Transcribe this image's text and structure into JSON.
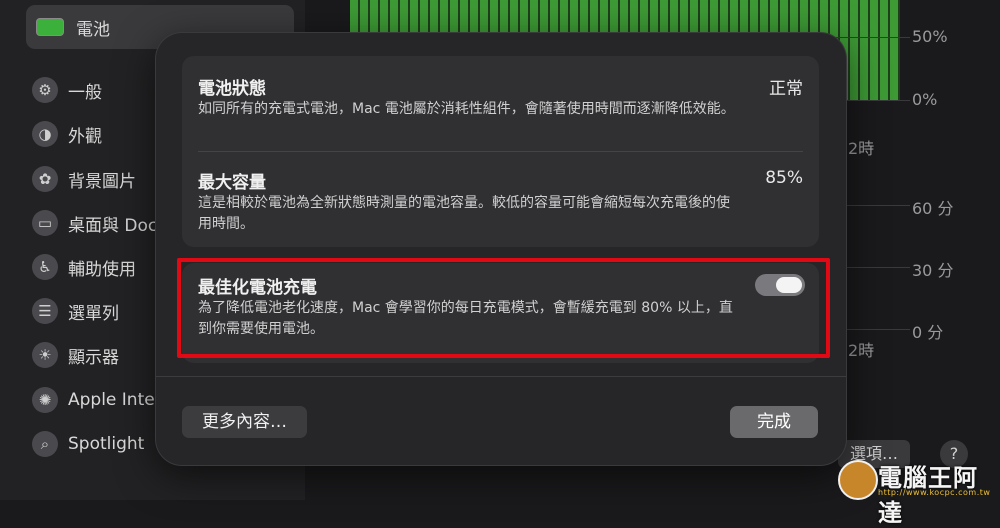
{
  "sidebar": {
    "selected": {
      "label": "電池",
      "icon": "battery-icon"
    },
    "items": [
      {
        "label": "一般",
        "icon": "gear-icon",
        "glyph": "⚙"
      },
      {
        "label": "外觀",
        "icon": "appearance-icon",
        "glyph": "◑"
      },
      {
        "label": "背景圖片",
        "icon": "wallpaper-icon",
        "glyph": "✿"
      },
      {
        "label": "桌面與 Doc",
        "icon": "desktop-dock-icon",
        "glyph": "▭"
      },
      {
        "label": "輔助使用",
        "icon": "accessibility-icon",
        "glyph": "♿"
      },
      {
        "label": "選單列",
        "icon": "menu-bar-icon",
        "glyph": "☰"
      },
      {
        "label": "顯示器",
        "icon": "display-icon",
        "glyph": "☀"
      },
      {
        "label": "Apple Intel",
        "icon": "apple-intelligence-icon",
        "glyph": "✺"
      },
      {
        "label": "Spotlight",
        "icon": "spotlight-icon",
        "glyph": "⌕"
      }
    ]
  },
  "background": {
    "axis_top": [
      "50%",
      "0%"
    ],
    "time_label_1": "2時",
    "axis_bottom": [
      "60 分",
      "30 分",
      "0 分"
    ],
    "time_label_2": "2時",
    "options_label": "選項…",
    "help_label": "?"
  },
  "modal": {
    "battery_status": {
      "title": "電池狀態",
      "value": "正常",
      "description": "如同所有的充電式電池，Mac 電池屬於消耗性組件，會隨著使用時間而逐漸降低效能。"
    },
    "max_capacity": {
      "title": "最大容量",
      "value": "85%",
      "description": "這是相較於電池為全新狀態時測量的電池容量。較低的容量可能會縮短每次充電後的使用時間。"
    },
    "optimized_charging": {
      "title": "最佳化電池充電",
      "enabled": true,
      "description": "為了降低電池老化速度，Mac 會學習你的每日充電模式，會暫緩充電到 80% 以上，直到你需要使用電池。"
    },
    "more_button": "更多內容…",
    "done_button": "完成"
  },
  "watermark": {
    "title": "電腦王阿達",
    "url": "http://www.kocpc.com.tw"
  },
  "colors": {
    "highlight": "#e10a14",
    "accent_green": "#3d9a35"
  }
}
